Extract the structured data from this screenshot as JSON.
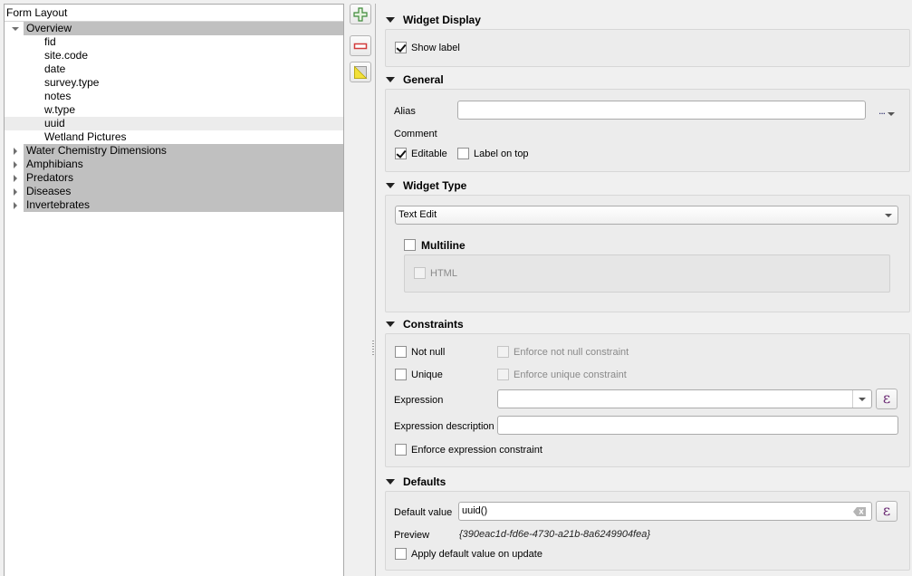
{
  "tree": {
    "header": "Form Layout",
    "items": [
      {
        "label": "Overview",
        "type": "container",
        "expanded": true
      },
      {
        "label": "fid",
        "type": "field"
      },
      {
        "label": "site.code",
        "type": "field"
      },
      {
        "label": "date",
        "type": "field"
      },
      {
        "label": "survey.type",
        "type": "field"
      },
      {
        "label": "notes",
        "type": "field"
      },
      {
        "label": "w.type",
        "type": "field"
      },
      {
        "label": "uuid",
        "type": "field",
        "selected": true
      },
      {
        "label": "Wetland Pictures",
        "type": "field"
      },
      {
        "label": "Water Chemistry Dimensions",
        "type": "container",
        "expanded": false
      },
      {
        "label": "Amphibians",
        "type": "container",
        "expanded": false
      },
      {
        "label": "Predators",
        "type": "container",
        "expanded": false
      },
      {
        "label": "Diseases",
        "type": "container",
        "expanded": false
      },
      {
        "label": "Invertebrates",
        "type": "container",
        "expanded": false
      }
    ]
  },
  "toolbar": {
    "add": "plus-icon",
    "remove": "minus-icon",
    "invert": "invert-selection-icon"
  },
  "widget_display": {
    "title": "Widget Display",
    "show_label": {
      "label": "Show label",
      "checked": true
    }
  },
  "general": {
    "title": "General",
    "alias_label": "Alias",
    "alias_value": "",
    "comment_label": "Comment",
    "editable": {
      "label": "Editable",
      "checked": true
    },
    "label_on_top": {
      "label": "Label on top",
      "checked": false
    },
    "more_button": "..."
  },
  "widget_type": {
    "title": "Widget Type",
    "selected": "Text Edit",
    "multiline": {
      "label": "Multiline",
      "checked": false
    },
    "html": {
      "label": "HTML",
      "checked": false,
      "enabled": false
    }
  },
  "constraints": {
    "title": "Constraints",
    "not_null": {
      "label": "Not null",
      "checked": false
    },
    "enforce_not_null": {
      "label": "Enforce not null constraint",
      "checked": false,
      "enabled": false
    },
    "unique": {
      "label": "Unique",
      "checked": false
    },
    "enforce_unique": {
      "label": "Enforce unique constraint",
      "checked": false,
      "enabled": false
    },
    "expression_label": "Expression",
    "expression_value": "",
    "expression_description_label": "Expression description",
    "expression_description_value": "",
    "enforce_expression": {
      "label": "Enforce expression constraint",
      "checked": false
    }
  },
  "defaults": {
    "title": "Defaults",
    "default_value_label": "Default value",
    "default_value": "uuid()",
    "preview_label": "Preview",
    "preview_value": "{390eac1d-fd6e-4730-a21b-8a6249904fea}",
    "apply_on_update": {
      "label": "Apply default value on update",
      "checked": false
    }
  },
  "colors": {
    "container_bg": "#c0c0c0",
    "selected_row": "#ececec",
    "expression_icon": "#6b2a74"
  }
}
